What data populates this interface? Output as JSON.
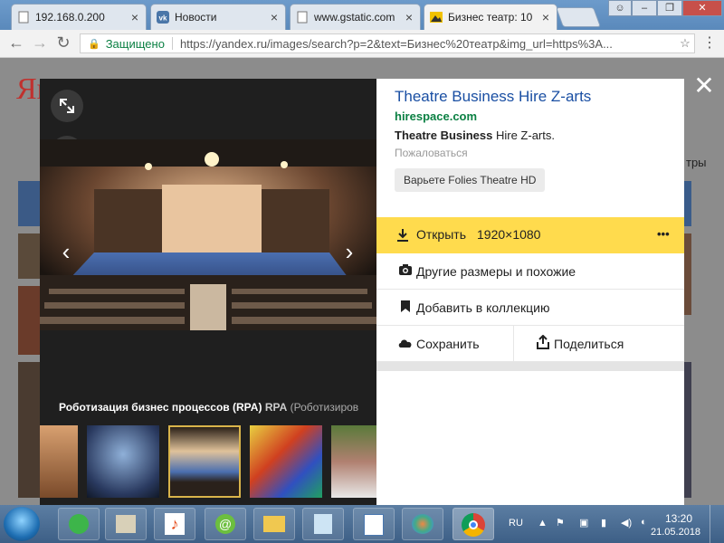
{
  "browser": {
    "tabs": [
      {
        "title": "192.168.0.200",
        "favicon": "page-icon"
      },
      {
        "title": "Новости",
        "favicon": "vk-icon"
      },
      {
        "title": "www.gstatic.com",
        "favicon": "page-icon"
      },
      {
        "title": "Бизнес театр: 10",
        "favicon": "image-icon"
      }
    ],
    "omnibox": {
      "security_label": "Защищено",
      "url": "https://yandex.ru/images/search?p=2&text=Бизнес%20театр&img_url=https%3A..."
    }
  },
  "page": {
    "logo_fragment": "Ян",
    "right_text": "тры"
  },
  "viewer": {
    "caption_bold": "Роботизация бизнес процессов (RPA)",
    "caption_tag": "RPA",
    "caption_rest": "(Роботизиров",
    "thumbnails": [
      "concert-hall-thumbnail",
      "dome-theatre-thumbnail",
      "stage-thumbnail-selected",
      "colorful-hall-thumbnail",
      "people-thumbnail"
    ]
  },
  "panel": {
    "title": "Theatre Business Hire Z-arts",
    "domain": "hirespace.com",
    "desc_bold": "Theatre Business",
    "desc_rest": " Hire Z-arts.",
    "report": "Пожаловаться",
    "tag": "Варьете Folies Theatre HD",
    "open_label": "Открыть",
    "open_size": "1920×1080",
    "more": "•••",
    "other_sizes": "Другие размеры и похожие",
    "add_collection": "Добавить в коллекцию",
    "save": "Сохранить",
    "share": "Поделиться"
  },
  "taskbar": {
    "lang": "RU",
    "time": "13:20",
    "date": "21.05.2018"
  },
  "colors": {
    "accent_yellow": "#ffdb4d",
    "link_blue": "#1a4fa3",
    "domain_green": "#0b8043"
  }
}
